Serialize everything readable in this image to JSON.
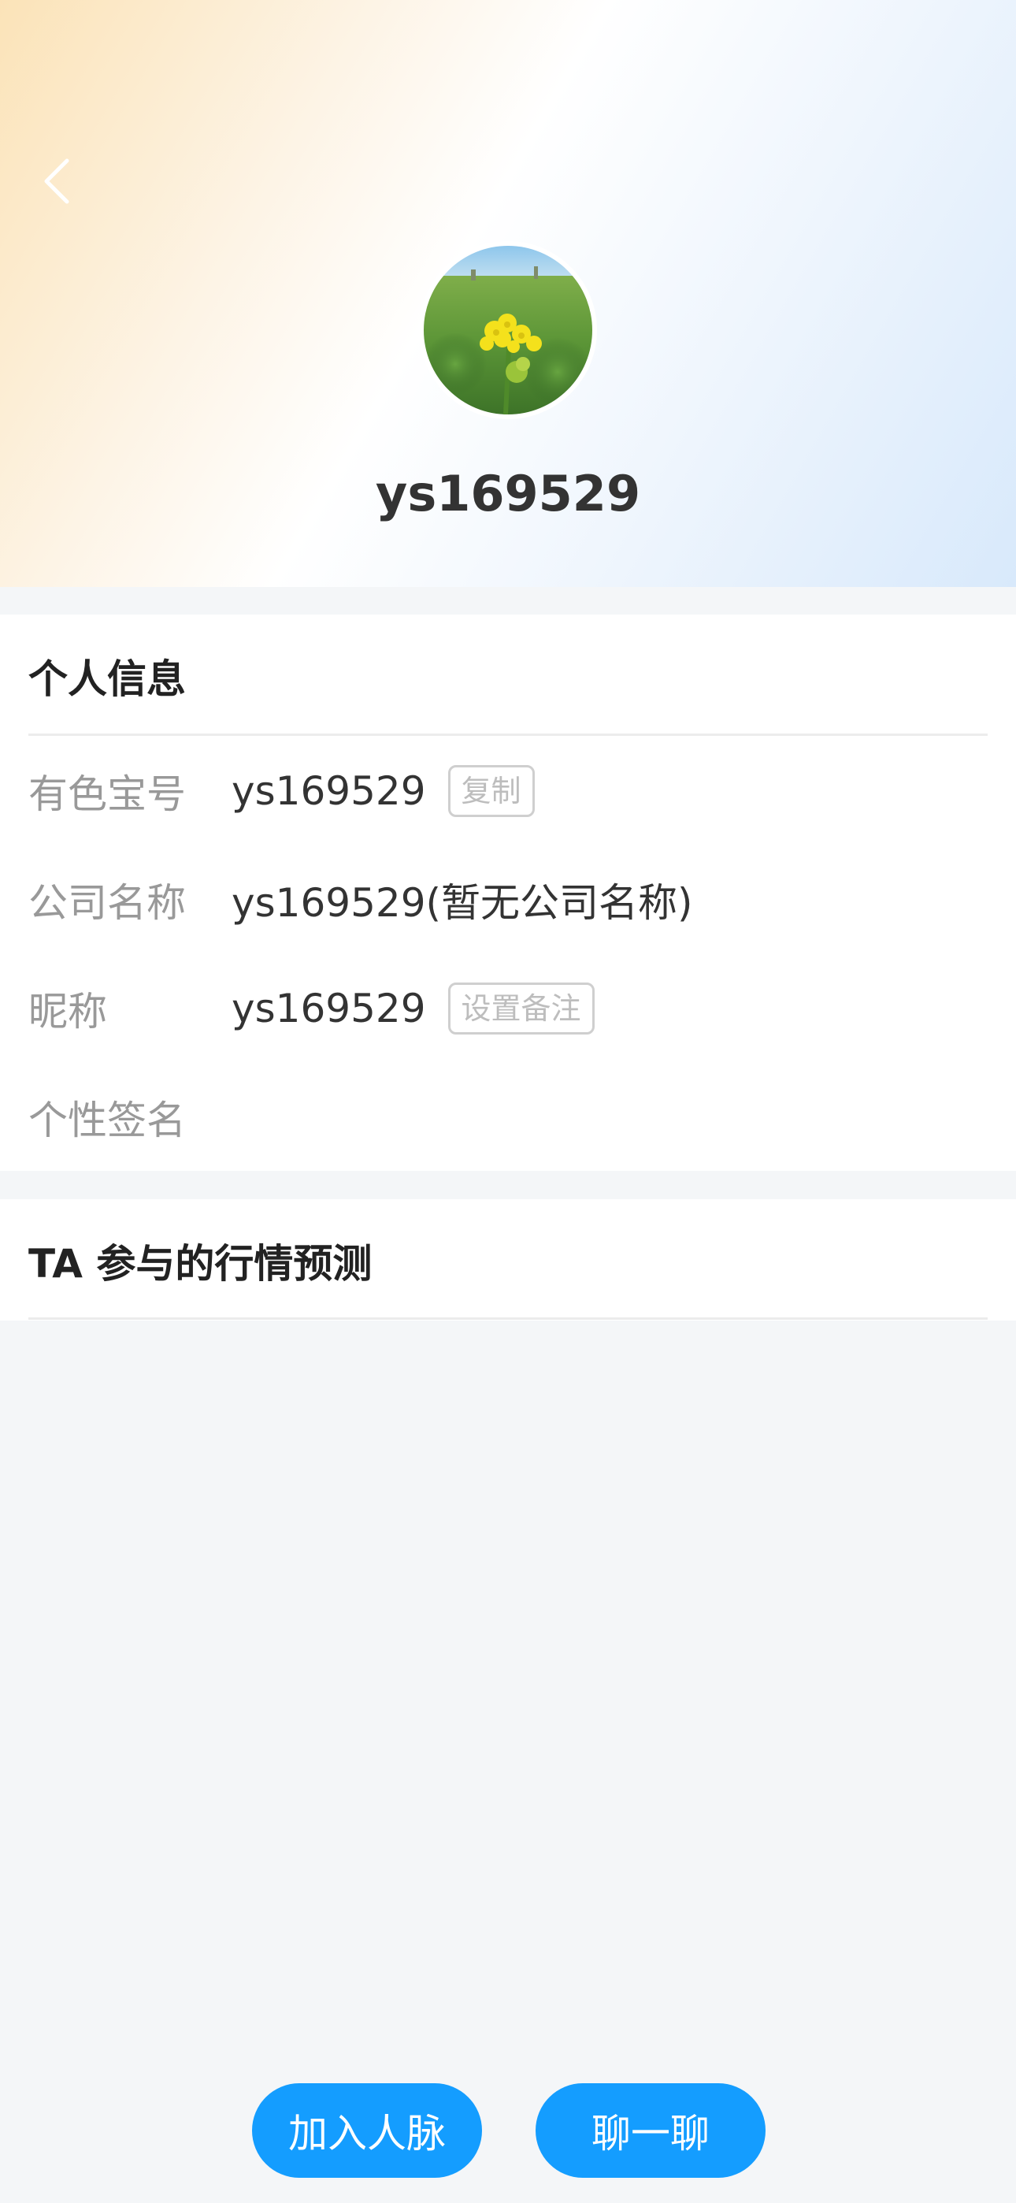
{
  "header": {
    "back_icon": "chevron-left-icon",
    "username": "ys169529"
  },
  "personal_info": {
    "title": "个人信息",
    "rows": [
      {
        "label": "有色宝号",
        "value": "ys169529",
        "action": "复制"
      },
      {
        "label": "公司名称",
        "value": "ys169529(暂无公司名称)"
      },
      {
        "label": "昵称",
        "value": "ys169529",
        "action": "设置备注"
      },
      {
        "label": "个性签名",
        "value": ""
      }
    ]
  },
  "predictions": {
    "title": "TA 参与的行情预测"
  },
  "buttons": {
    "add_contact": "加入人脉",
    "chat": "聊一聊"
  },
  "colors": {
    "accent": "#149dff",
    "background": "#f4f6f8"
  }
}
